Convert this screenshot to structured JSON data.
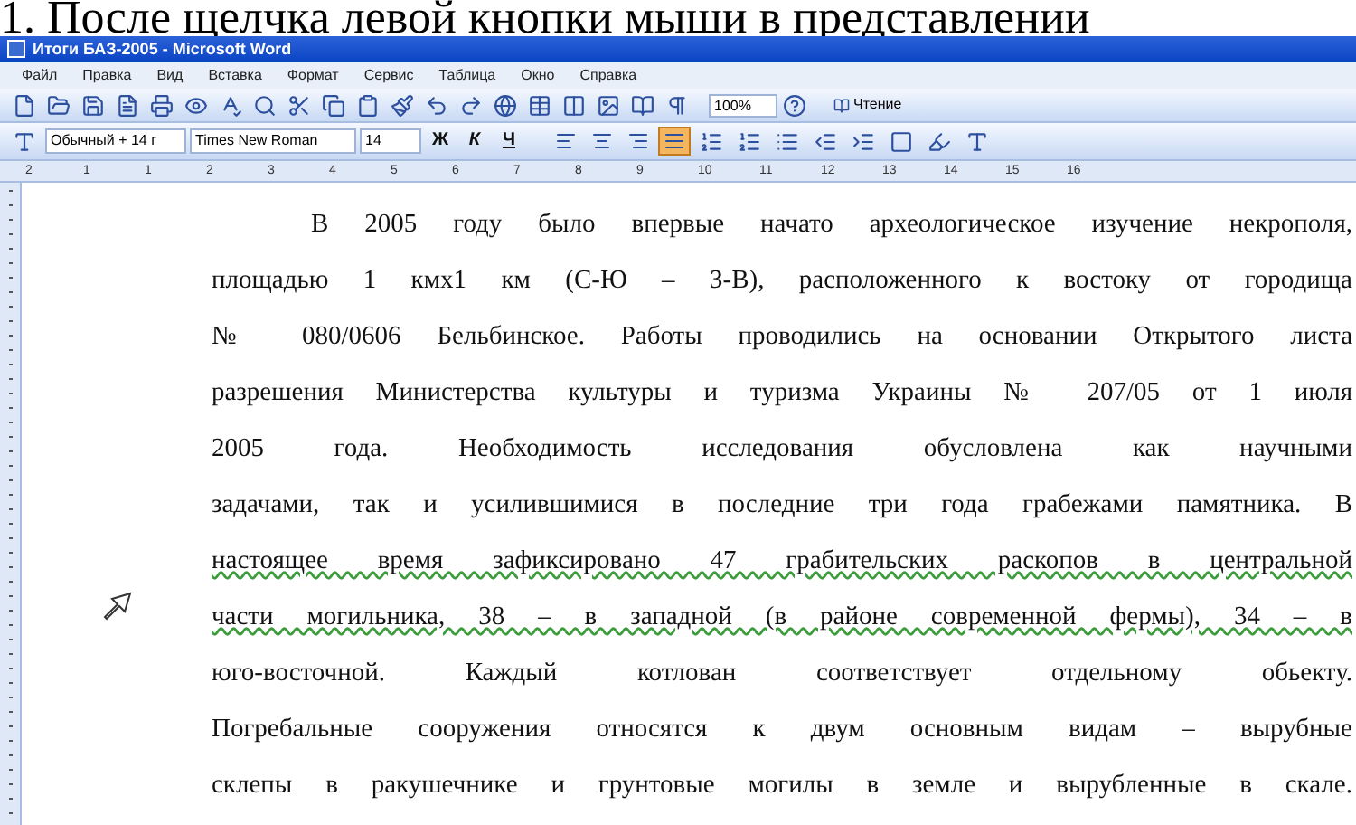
{
  "caption": "1. После щелчка левой кнопки мыши в представлении",
  "window": {
    "title": "Итоги БАЗ-2005 - Microsoft Word"
  },
  "menu": [
    "Файл",
    "Правка",
    "Вид",
    "Вставка",
    "Формат",
    "Сервис",
    "Таблица",
    "Окно",
    "Справка"
  ],
  "standard_toolbar": {
    "zoom": "100%",
    "reading_button": "Чтение"
  },
  "format_toolbar": {
    "style": "Обычный + 14 г",
    "font": "Times New Roman",
    "size": "14",
    "text_buttons": [
      "Ж",
      "К",
      "Ч"
    ],
    "alignments": [
      {
        "kind": "left",
        "selected": false
      },
      {
        "kind": "center",
        "selected": false
      },
      {
        "kind": "right",
        "selected": false
      },
      {
        "kind": "justify",
        "selected": true
      }
    ]
  },
  "ruler": [
    "2",
    "1",
    "1",
    "2",
    "3",
    "4",
    "5",
    "6",
    "7",
    "8",
    "9",
    "10",
    "11",
    "12",
    "13",
    "14",
    "15",
    "16"
  ],
  "document": {
    "lines": [
      {
        "text": "В 2005 году было впервые начато археологическое изучение некрополя,",
        "indent": true,
        "grammar": false
      },
      {
        "text": "площадью 1 кмх1 км (С-Ю – З-В), расположенного к востоку от городища",
        "indent": false,
        "grammar": false
      },
      {
        "text": "№ 080/0606 Бельбинское. Работы проводились на основании Открытого листа",
        "indent": false,
        "grammar": false
      },
      {
        "text": "разрешения Министерства культуры и туризма Украины № 207/05 от 1 июля",
        "indent": false,
        "grammar": false
      },
      {
        "text": "2005 года. Необходимость исследования обусловлена как научными",
        "indent": false,
        "grammar": false
      },
      {
        "text": "задачами, так и усилившимися в последние три года грабежами памятника. В",
        "indent": false,
        "grammar": false
      },
      {
        "text": "настоящее время зафиксировано 47 грабительских раскопов в центральной",
        "indent": false,
        "grammar": true
      },
      {
        "text": "части могильника, 38 – в западной (в районе современной фермы), 34 – в",
        "indent": false,
        "grammar": true
      },
      {
        "text": "юго-восточной. Каждый котлован соответствует отдельному обьекту.",
        "indent": false,
        "grammar": false
      },
      {
        "text": "Погребальные сооружения относятся к двум основным видам – вырубные",
        "indent": false,
        "grammar": false
      },
      {
        "text": "склепы в ракушечнике и грунтовые могилы в земле и вырубленные в скале.",
        "indent": false,
        "grammar": false
      }
    ]
  }
}
